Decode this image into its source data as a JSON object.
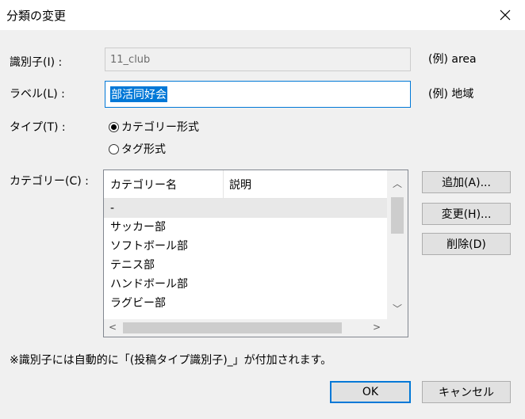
{
  "window": {
    "title": "分類の変更"
  },
  "fields": {
    "identifier": {
      "label": "識別子(I) :",
      "value": "11_club",
      "example": "(例) area"
    },
    "label": {
      "label": "ラベル(L) :",
      "value": "部活同好会",
      "example": "(例) 地域"
    },
    "type": {
      "label": "タイプ(T) :",
      "options": [
        "カテゴリー形式",
        "タグ形式"
      ],
      "selected": "カテゴリー形式"
    }
  },
  "categories": {
    "label": "カテゴリー(C) :",
    "columns": [
      "カテゴリー名",
      "説明"
    ],
    "rows": [
      "-",
      "サッカー部",
      "ソフトボール部",
      "テニス部",
      "ハンドボール部",
      "ラグビー部"
    ]
  },
  "buttons": {
    "add": "追加(A)...",
    "change": "変更(H)...",
    "delete": "削除(D)",
    "ok": "OK",
    "cancel": "キャンセル"
  },
  "note": "※識別子には自動的に「(投稿タイプ識別子)_」が付加されます。",
  "icons": {
    "close": "close-icon",
    "scroll_up": "chevron-up-icon",
    "scroll_down": "chevron-down-icon",
    "scroll_left": "chevron-left-icon",
    "scroll_right": "chevron-right-icon"
  },
  "colors": {
    "accent": "#0078d7",
    "background": "#f0f0f0"
  }
}
